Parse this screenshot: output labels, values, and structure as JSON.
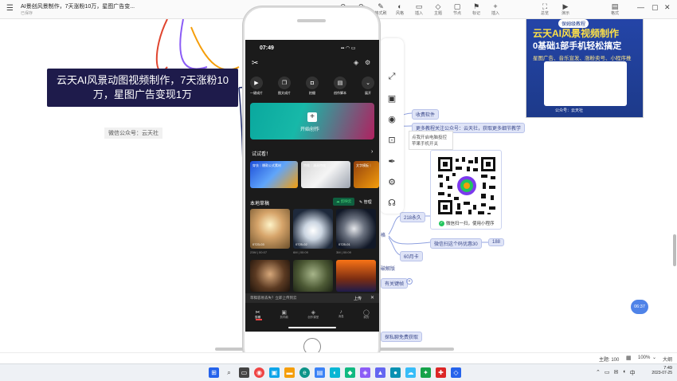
{
  "window": {
    "title": "AI景创风景制作，7天涨粉10万，星图广告变...",
    "subtitle": "已保存",
    "toolbar": [
      {
        "label": "撤销",
        "icon": "undo-icon"
      },
      {
        "label": "恢复",
        "icon": "redo-icon"
      },
      {
        "label": "格式刷",
        "icon": "format-brush-icon"
      },
      {
        "label": "风格",
        "icon": "style-icon"
      },
      {
        "label": "插入",
        "icon": "insert-icon"
      },
      {
        "label": "主题",
        "icon": "theme-icon"
      },
      {
        "label": "节点",
        "icon": "node-icon"
      },
      {
        "label": "标记",
        "icon": "mark-icon"
      },
      {
        "label": "插入",
        "icon": "plus-icon"
      }
    ],
    "right_toolbar": [
      {
        "label": "总览",
        "icon": "overview-icon"
      },
      {
        "label": "演示",
        "icon": "present-icon"
      },
      {
        "label": "格式",
        "icon": "format-icon"
      }
    ]
  },
  "mindmap": {
    "central_node": "云天AI风景动图视频制作，7天涨粉10万，星图广告变现1万",
    "wechat_node": "微信公众号：云天社",
    "nodes": {
      "paid_software": "收费软件",
      "follow_note": "更多教程关注公众号：云天社，获取更多细节教学",
      "tooltip_line1": "点我开启电脑投控",
      "tooltip_line2": "苹果手机开关",
      "permanent": "218永久",
      "coupon": "微信扫这个码优惠30",
      "coupon_price": "188",
      "month_card": "60月卡",
      "qr_caption": "微信扫一扫，使用小程序",
      "fragment_a": "格",
      "fragment_b": "破解版",
      "fragment_c": "有关键帧",
      "fragment_d": "探私聊免费获取"
    },
    "poster": {
      "badge": "保姆级教程",
      "title_line1": "云天AI风景视频制作",
      "title_line2": "0基础1部手机轻松搞定",
      "tags": "星图广告、音乐宣发、涨粉卖号、小程序推",
      "footer": "公众号：云天社"
    },
    "float_badge": "06:37"
  },
  "phone": {
    "time": "07:49",
    "quick_actions": [
      "一键成片",
      "图文成片",
      "拍摄",
      "创作脚本",
      "展开"
    ],
    "start_button": "开始创作",
    "try_section": "试试看！",
    "try_cards": [
      "穿衣｜爆款公式素材",
      "特效｜漫画特效",
      "文字模板｜"
    ],
    "drafts_label": "本地草稿",
    "cloud_label": "剪映云",
    "manage_label": "管理",
    "drafts": [
      {
        "date": "0723-03",
        "meta": "23M | 00:07"
      },
      {
        "date": "0725-02",
        "meta": "6M | 00:09"
      },
      {
        "date": "0725-01",
        "meta": "3M | 00:09"
      }
    ],
    "upload_bar": "草稿容易丢失？立即上传到云",
    "upload_btn": "上传",
    "nav": [
      "剪辑",
      "剪同款",
      "创作课堂",
      "消息",
      "我的"
    ]
  },
  "status": {
    "theme": "主题: 100",
    "zoom": "100%",
    "size": "大纲"
  },
  "taskbar": {
    "time": "7:49",
    "date": "2023-07-25"
  },
  "colors": {
    "central_bg": "#1e1b4b",
    "node_bg": "#dfe4f7",
    "accent": "#3c4a8c",
    "poster_bg": "#1e3a8a"
  }
}
